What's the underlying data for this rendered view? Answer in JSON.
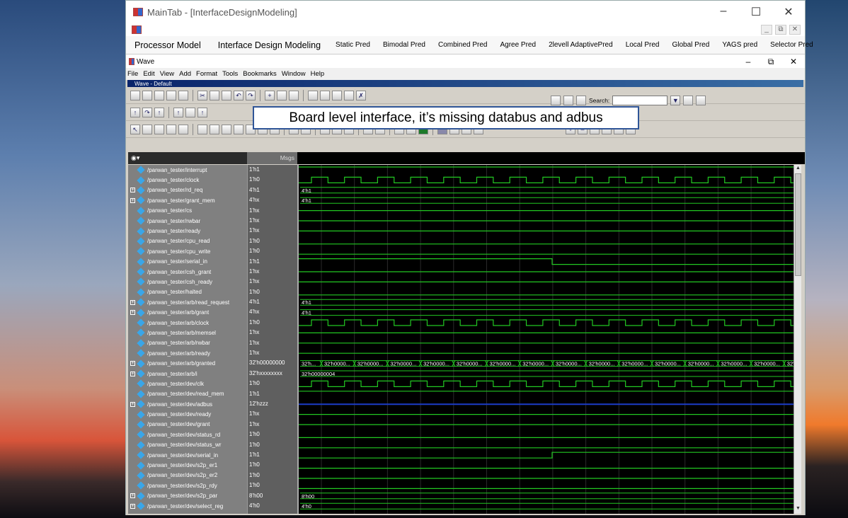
{
  "window": {
    "title": "MainTab - [InterfaceDesignModeling]"
  },
  "tabs": [
    {
      "label": "Processor Model",
      "big": true
    },
    {
      "label": "Interface Design  Modeling",
      "big": true
    },
    {
      "label": "Static Pred",
      "big": false
    },
    {
      "label": "Bimodal Pred",
      "big": false
    },
    {
      "label": "Combined  Pred",
      "big": false
    },
    {
      "label": "Agree Pred",
      "big": false
    },
    {
      "label": "2levell AdaptivePred",
      "big": false
    },
    {
      "label": "Local Pred",
      "big": false
    },
    {
      "label": "Global  Pred",
      "big": false
    },
    {
      "label": "YAGS pred",
      "big": false
    },
    {
      "label": "Selector Pred",
      "big": false
    }
  ],
  "wave": {
    "title": "Wave",
    "subtitle": "Wave - Default",
    "menu": [
      "File",
      "Edit",
      "View",
      "Add",
      "Format",
      "Tools",
      "Bookmarks",
      "Window",
      "Help"
    ],
    "search_label": "Search:",
    "msgs_header": "Msgs"
  },
  "annotation": "Board level interface, it’s missing databus and adbus",
  "signals": [
    {
      "name": "/parwan_tester/interrupt",
      "value": "1'h1",
      "exp": false,
      "wave": "high"
    },
    {
      "name": "/parwan_tester/clock",
      "value": "1'h0",
      "exp": false,
      "wave": "clock"
    },
    {
      "name": "/parwan_tester/rd_req",
      "value": "4'h1",
      "exp": true,
      "wave": "bus",
      "bus_label": "4'h1"
    },
    {
      "name": "/parwan_tester/grant_mem",
      "value": "4'hx",
      "exp": true,
      "wave": "bus",
      "bus_label": "4'h1"
    },
    {
      "name": "/parwan_tester/cs",
      "value": "1'hx",
      "exp": false,
      "wave": "mid"
    },
    {
      "name": "/parwan_tester/rwbar",
      "value": "1'hx",
      "exp": false,
      "wave": "mid"
    },
    {
      "name": "/parwan_tester/ready",
      "value": "1'hx",
      "exp": false,
      "wave": "mid"
    },
    {
      "name": "/parwan_tester/cpu_read",
      "value": "1'h0",
      "exp": false,
      "wave": "low"
    },
    {
      "name": "/parwan_tester/cpu_write",
      "value": "1'h0",
      "exp": false,
      "wave": "low"
    },
    {
      "name": "/parwan_tester/serial_in",
      "value": "1'h1",
      "exp": false,
      "wave": "step_down"
    },
    {
      "name": "/parwan_tester/csh_grant",
      "value": "1'hx",
      "exp": false,
      "wave": "mid"
    },
    {
      "name": "/parwan_tester/csh_ready",
      "value": "1'hx",
      "exp": false,
      "wave": "mid"
    },
    {
      "name": "/parwan_tester/halted",
      "value": "1'h0",
      "exp": false,
      "wave": "low"
    },
    {
      "name": "/parwan_tester/arb/read_request",
      "value": "4'h1",
      "exp": true,
      "wave": "bus",
      "bus_label": "4'h1"
    },
    {
      "name": "/parwan_tester/arb/grant",
      "value": "4'hx",
      "exp": true,
      "wave": "bus",
      "bus_label": "4'h1"
    },
    {
      "name": "/parwan_tester/arb/clock",
      "value": "1'h0",
      "exp": false,
      "wave": "clock"
    },
    {
      "name": "/parwan_tester/arb/memsel",
      "value": "1'hx",
      "exp": false,
      "wave": "mid"
    },
    {
      "name": "/parwan_tester/arb/rwbar",
      "value": "1'hx",
      "exp": false,
      "wave": "mid"
    },
    {
      "name": "/parwan_tester/arb/ready",
      "value": "1'hx",
      "exp": false,
      "wave": "mid"
    },
    {
      "name": "/parwan_tester/arb/granted",
      "value": "32'h00000000",
      "exp": true,
      "wave": "busseg",
      "bus_label": "32'h0000..."
    },
    {
      "name": "/parwan_tester/arb/i",
      "value": "32'hxxxxxxxx",
      "exp": true,
      "wave": "bus",
      "bus_label": "32'h00000004"
    },
    {
      "name": "/parwan_tester/dev/clk",
      "value": "1'h0",
      "exp": false,
      "wave": "clock"
    },
    {
      "name": "/parwan_tester/dev/read_mem",
      "value": "1'h1",
      "exp": false,
      "wave": "high"
    },
    {
      "name": "/parwan_tester/dev/adbus",
      "value": "12'hzzz",
      "exp": true,
      "wave": "hiz"
    },
    {
      "name": "/parwan_tester/dev/ready",
      "value": "1'hx",
      "exp": false,
      "wave": "mid"
    },
    {
      "name": "/parwan_tester/dev/grant",
      "value": "1'hx",
      "exp": false,
      "wave": "mid"
    },
    {
      "name": "/parwan_tester/dev/status_rd",
      "value": "1'h0",
      "exp": false,
      "wave": "low"
    },
    {
      "name": "/parwan_tester/dev/status_wr",
      "value": "1'h0",
      "exp": false,
      "wave": "low"
    },
    {
      "name": "/parwan_tester/dev/serial_in",
      "value": "1'h1",
      "exp": false,
      "wave": "step_up"
    },
    {
      "name": "/parwan_tester/dev/s2p_er1",
      "value": "1'h0",
      "exp": false,
      "wave": "low"
    },
    {
      "name": "/parwan_tester/dev/s2p_er2",
      "value": "1'h0",
      "exp": false,
      "wave": "low"
    },
    {
      "name": "/parwan_tester/dev/s2p_rdy",
      "value": "1'h0",
      "exp": false,
      "wave": "low"
    },
    {
      "name": "/parwan_tester/dev/s2p_par",
      "value": "8'h00",
      "exp": true,
      "wave": "bus",
      "bus_label": "8'h00"
    },
    {
      "name": "/parwan_tester/dev/select_reg",
      "value": "4'h0",
      "exp": true,
      "wave": "bus",
      "bus_label": "4'h0"
    }
  ],
  "colors": {
    "wave": "#22c822",
    "hiz": "#1c3cc8",
    "grid": "#2a2a2a",
    "annot_border": "#2f5597"
  }
}
